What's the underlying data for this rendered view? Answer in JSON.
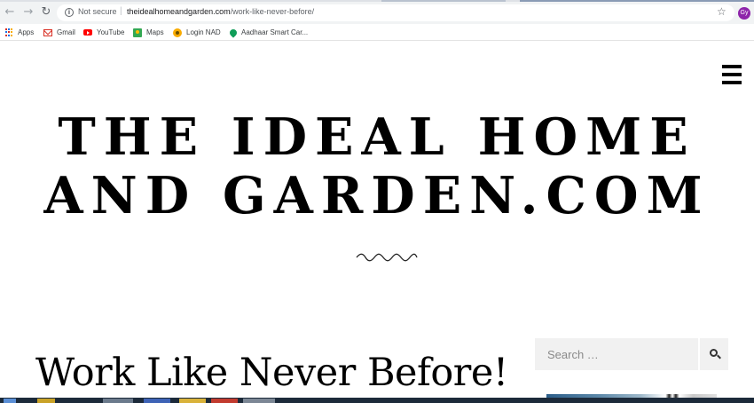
{
  "browser": {
    "address": {
      "security_label": "Not secure",
      "separator": "|",
      "url_host": "theidealhomeandgarden.com",
      "url_path": "/work-like-never-before/"
    },
    "profile_initials": "Gy",
    "bookmarks": [
      {
        "label": "Apps",
        "icon": "apps-grid-icon"
      },
      {
        "label": "Gmail",
        "icon": "gmail-icon"
      },
      {
        "label": "YouTube",
        "icon": "youtube-icon"
      },
      {
        "label": "Maps",
        "icon": "maps-icon"
      },
      {
        "label": "Login NAD",
        "icon": "nad-icon"
      },
      {
        "label": "Aadhaar Smart Car...",
        "icon": "location-pin-icon"
      }
    ]
  },
  "page": {
    "site_title": "THE IDEAL HOME AND GARDEN.COM",
    "post_title": "Work Like Never Before!",
    "search": {
      "placeholder": "Search …"
    }
  },
  "colors": {
    "text": "#000000",
    "search_bg": "#f1f1f1",
    "not_secure_text": "#5f6368"
  }
}
